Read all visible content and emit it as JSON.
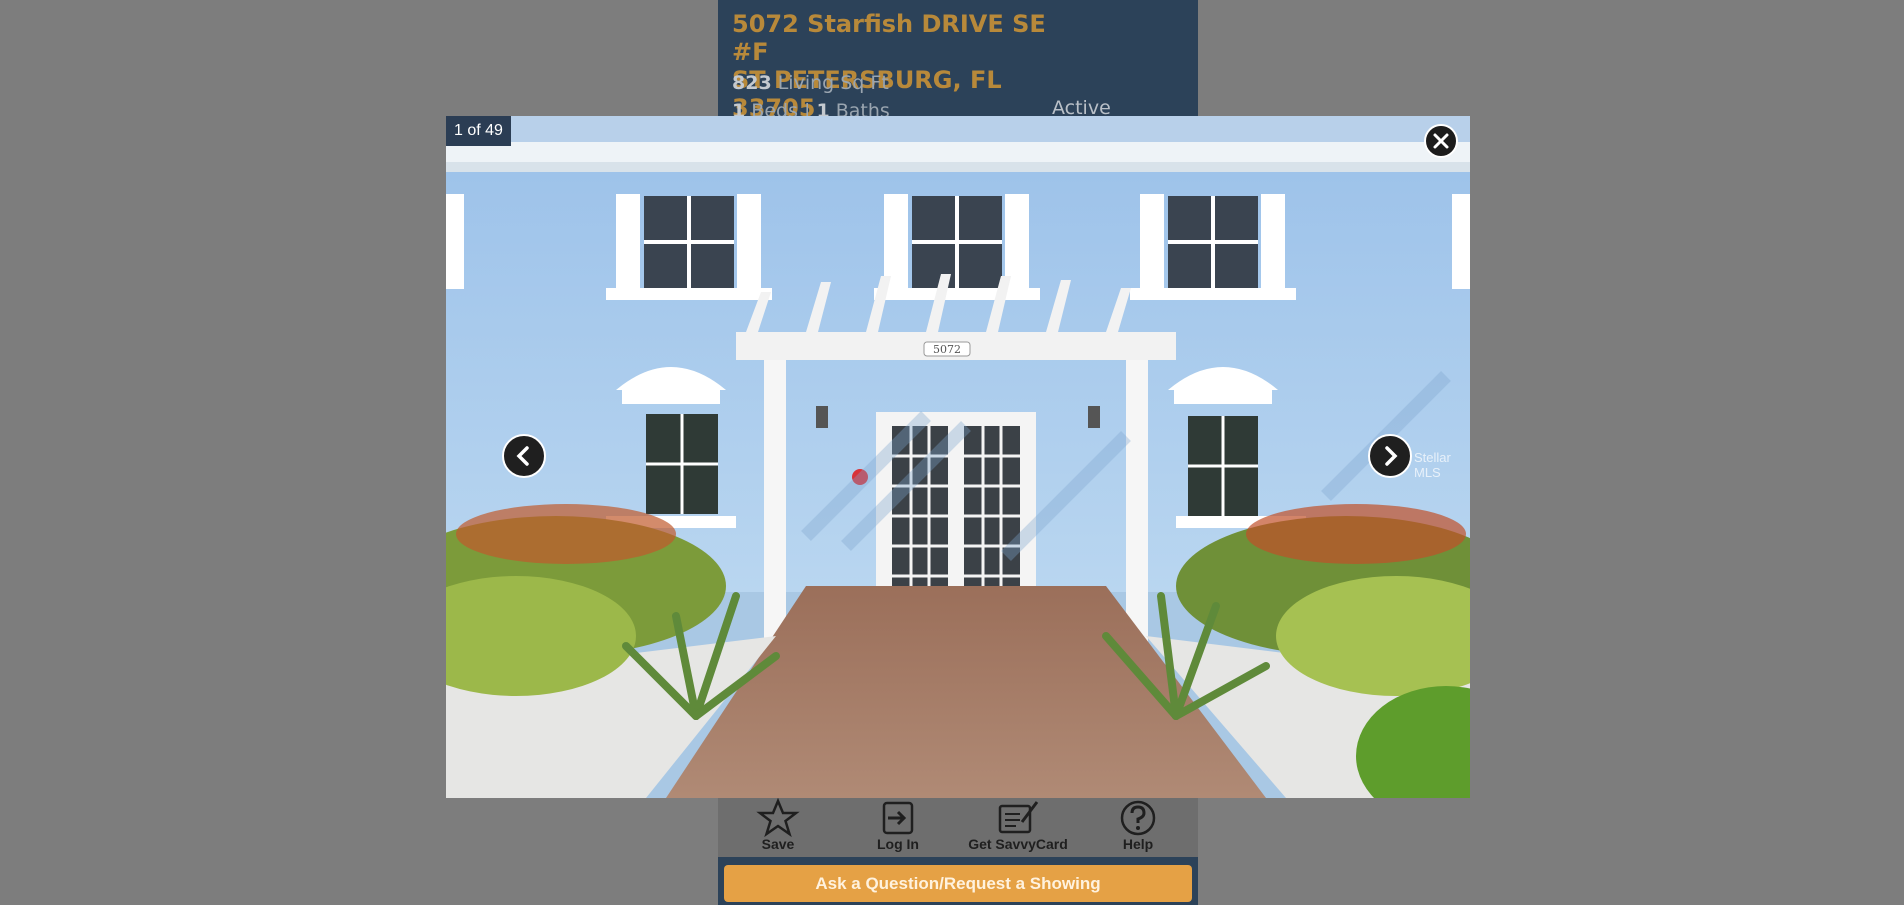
{
  "listing": {
    "address_line1": "5072 Starfish DRIVE SE #F",
    "address_line2": "ST PETERSBURG, FL 33705",
    "sqft_value": "823",
    "sqft_label": "Living Sq Ft",
    "beds_value": "1",
    "beds_label": "Beds",
    "baths_value": "1",
    "baths_label": "Baths",
    "status": "Active"
  },
  "toolbar": {
    "save_label": "Save",
    "login_label": "Log In",
    "savvycard_label": "Get SavvyCard",
    "help_label": "Help"
  },
  "cta": {
    "ask_label": "Ask a Question/Request a Showing"
  },
  "viewer": {
    "counter": "1 of 49",
    "watermark": "Stellar MLS",
    "house_number": "5072"
  },
  "icons": {
    "close": "close-icon",
    "prev": "chevron-left-icon",
    "next": "chevron-right-icon",
    "save": "star-icon",
    "login": "login-icon",
    "savvycard": "card-pen-icon",
    "help": "question-circle-icon"
  },
  "colors": {
    "panel_bg": "#2c4259",
    "address_text": "#b8893a",
    "cta_bg": "#e5a145",
    "counter_bg": "#2b3d54",
    "page_bg": "#7d7d7d"
  }
}
